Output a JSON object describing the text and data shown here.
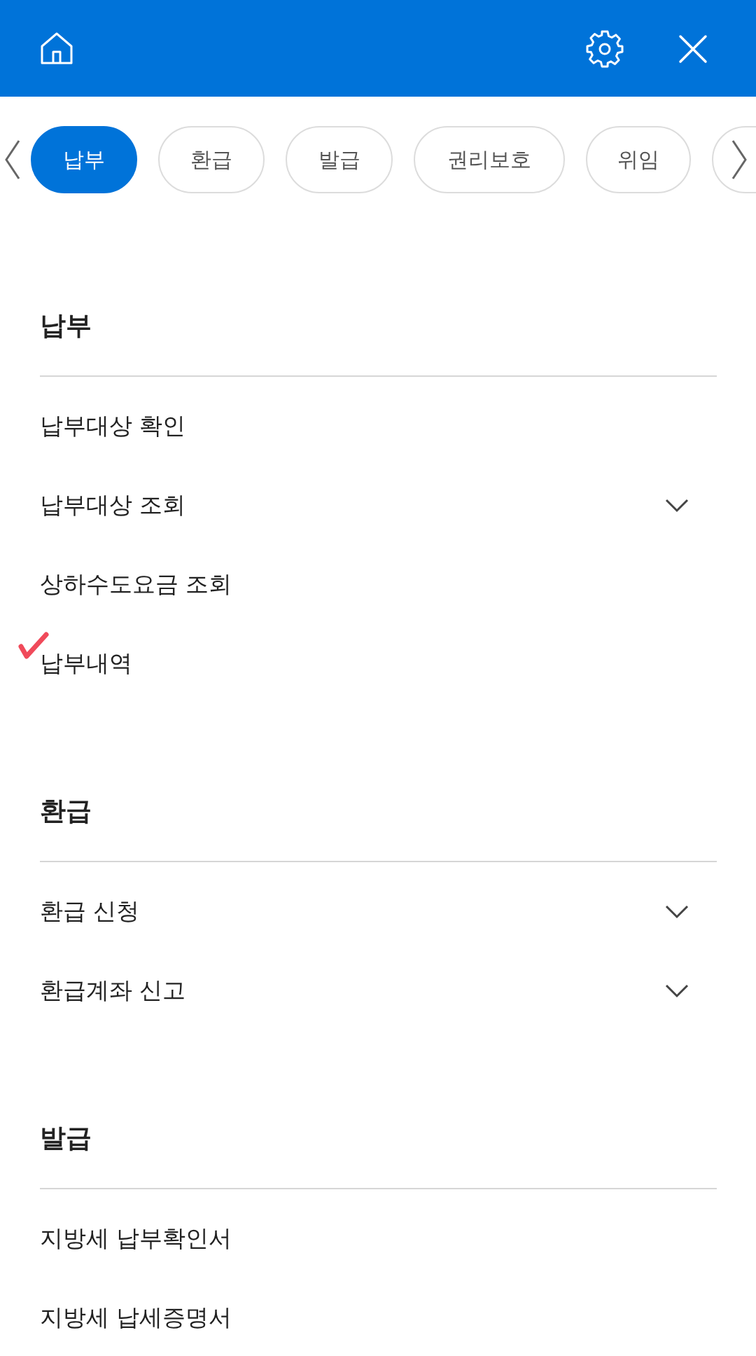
{
  "tabs": [
    {
      "label": "납부",
      "selected": true
    },
    {
      "label": "환급",
      "selected": false
    },
    {
      "label": "발급",
      "selected": false
    },
    {
      "label": "권리보호",
      "selected": false
    },
    {
      "label": "위임",
      "selected": false
    }
  ],
  "sections": [
    {
      "title": "납부",
      "items": [
        {
          "label": "납부대상 확인",
          "expandable": false,
          "annotated": false
        },
        {
          "label": "납부대상 조회",
          "expandable": true,
          "annotated": false
        },
        {
          "label": "상하수도요금 조회",
          "expandable": false,
          "annotated": false
        },
        {
          "label": "납부내역",
          "expandable": false,
          "annotated": true
        }
      ]
    },
    {
      "title": "환급",
      "items": [
        {
          "label": "환급 신청",
          "expandable": true,
          "annotated": false
        },
        {
          "label": "환급계좌 신고",
          "expandable": true,
          "annotated": false
        }
      ]
    },
    {
      "title": "발급",
      "items": [
        {
          "label": "지방세 납부확인서",
          "expandable": false,
          "annotated": false
        },
        {
          "label": "지방세 납세증명서",
          "expandable": false,
          "annotated": false
        }
      ]
    }
  ]
}
